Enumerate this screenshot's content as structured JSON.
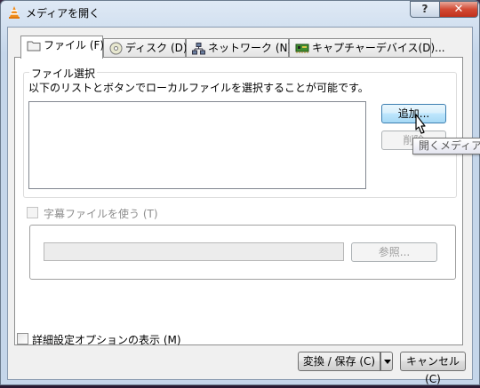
{
  "window": {
    "title": "メディアを開く",
    "help_label": "?",
    "close_label": "✕"
  },
  "tabs": [
    {
      "label": "ファイル (F)",
      "icon": "folder-icon"
    },
    {
      "label": "ディスク (D)",
      "icon": "disc-icon"
    },
    {
      "label": "ネットワーク (N)",
      "icon": "network-icon"
    },
    {
      "label": "キャプチャーデバイス(D)...",
      "icon": "capture-card-icon"
    }
  ],
  "file_selection": {
    "legend": "ファイル選択",
    "description": "以下のリストとボタンでローカルファイルを選択することが可能です。",
    "add_label": "追加...",
    "remove_label": "削除",
    "tooltip": "開くメディア"
  },
  "subtitle": {
    "checkbox_label": "字幕ファイルを使う (T)",
    "browse_label": "参照..."
  },
  "footer": {
    "advanced_label": "詳細設定オプションの表示 (M)",
    "convert_label": "変換 / 保存 (C)",
    "cancel_label": "キャンセル (C)"
  }
}
